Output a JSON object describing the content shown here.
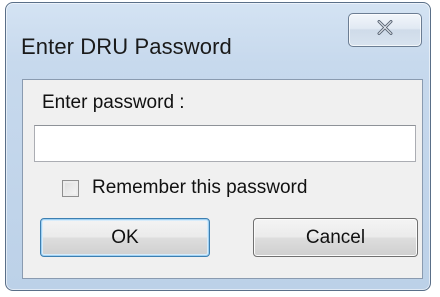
{
  "window": {
    "title": "Enter DRU Password"
  },
  "dialog": {
    "prompt_label": "Enter password :",
    "password_value": "",
    "remember_label": "Remember this password",
    "remember_checked": false,
    "ok_label": "OK",
    "cancel_label": "Cancel"
  },
  "icons": {
    "close": "close-icon"
  },
  "colors": {
    "frame": "#c7d9ed",
    "client": "#f0f0f0",
    "default_button_border": "#3c7fb1"
  }
}
